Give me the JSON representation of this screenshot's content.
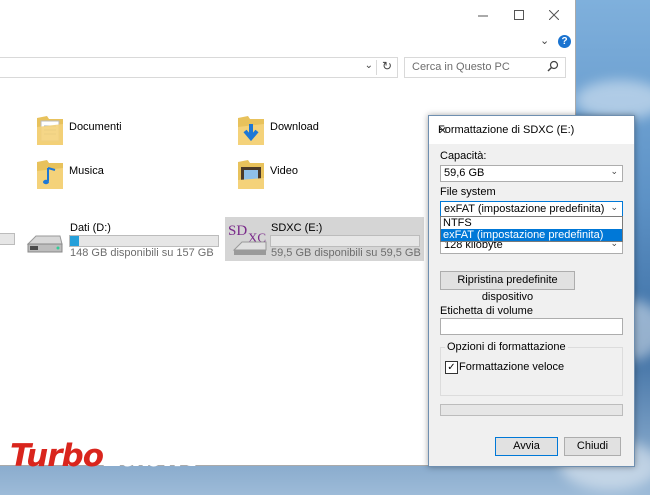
{
  "explorer": {
    "address": {
      "value": ""
    },
    "search": {
      "placeholder": "Cerca in Questo PC"
    },
    "folders": [
      {
        "label": "Documenti",
        "icon": "documents-folder-icon"
      },
      {
        "label": "Download",
        "icon": "downloads-folder-icon"
      },
      {
        "label": "Musica",
        "icon": "music-folder-icon"
      },
      {
        "label": "Video",
        "icon": "videos-folder-icon"
      }
    ],
    "drives": [
      {
        "name": "Dati (D:)",
        "free": "148 GB disponibili su 157 GB",
        "used_fraction": 0.06
      },
      {
        "name": "SDXC (E:)",
        "free": "59,5 GB disponibili su 59,5 GB",
        "used_fraction": 0.0
      }
    ]
  },
  "dialog": {
    "title": "Formattazione di SDXC (E:)",
    "capacity_label": "Capacità:",
    "capacity_value": "59,6 GB",
    "filesystem_label": "File system",
    "filesystem_value": "exFAT (impostazione predefinita)",
    "filesystem_options": [
      "NTFS",
      "exFAT (impostazione predefinita)"
    ],
    "allocation_value": "128 kilobyte",
    "restore_button": "Ripristina predefinite dispositivo",
    "volume_label": "Etichetta di volume",
    "volume_value": "",
    "options_group": "Opzioni di formattazione",
    "quick_format_label": "Formattazione veloce",
    "quick_format_checked": "✓",
    "start_button": "Avvia",
    "close_button": "Chiudi"
  },
  "watermark": {
    "part1": "Turbo",
    "part2": "Lab.it"
  },
  "colors": {
    "accent": "#0078d7",
    "drive_fill": "#26a0da",
    "watermark_red": "#d9251d"
  }
}
